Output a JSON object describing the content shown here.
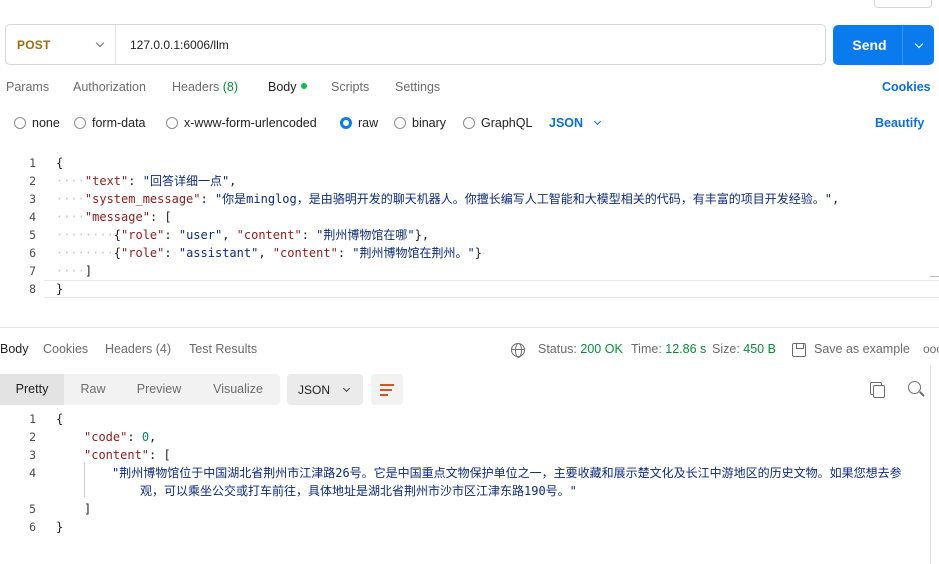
{
  "request": {
    "method": "POST",
    "url": "127.0.0.1:6006/llm",
    "send_label": "Send"
  },
  "request_tabs": {
    "params": "Params",
    "authorization": "Authorization",
    "headers": "Headers",
    "headers_count": "(8)",
    "body": "Body",
    "scripts": "Scripts",
    "settings": "Settings",
    "cookies": "Cookies"
  },
  "body_types": {
    "none": "none",
    "form_data": "form-data",
    "urlencoded": "x-www-form-urlencoded",
    "raw": "raw",
    "binary": "binary",
    "graphql": "GraphQL",
    "raw_format": "JSON",
    "beautify": "Beautify"
  },
  "request_body": {
    "line_numbers": [
      "1",
      "2",
      "3",
      "4",
      "5",
      "6",
      "7",
      "8"
    ],
    "open_brace": "{",
    "text_key": "\"text\"",
    "text_value": "\"回答详细一点\"",
    "system_key": "\"system_message\"",
    "system_value": "\"你是minglog，是由骆明开发的聊天机器人。你擅长编写人工智能和大模型相关的代码，有丰富的项目开发经验。\"",
    "message_key": "\"message\"",
    "role_key": "\"role\"",
    "content_key": "\"content\"",
    "msg1_role": "\"user\"",
    "msg1_content": "\"荆州博物馆在哪\"",
    "msg2_role": "\"assistant\"",
    "msg2_content": "\"荆州博物馆在荆州。\"",
    "close_bracket": "]",
    "close_brace": "}"
  },
  "response_tabs": {
    "body": "Body",
    "cookies": "Cookies",
    "headers": "Headers (4)",
    "test_results": "Test Results"
  },
  "response_meta": {
    "status_label": "Status:",
    "status_value": "200 OK",
    "time_label": "Time:",
    "time_value": "12.86 s",
    "size_label": "Size:",
    "size_value": "450 B",
    "save_example": "Save as example",
    "more": "ooo"
  },
  "response_views": {
    "pretty": "Pretty",
    "raw": "Raw",
    "preview": "Preview",
    "visualize": "Visualize",
    "format": "JSON"
  },
  "response_body": {
    "line_numbers": [
      "1",
      "2",
      "3",
      "4",
      "",
      "5",
      "6"
    ],
    "open_brace": "{",
    "code_key": "\"code\"",
    "code_value": "0",
    "content_key": "\"content\"",
    "content_line1": "\"荆州博物馆位于中国湖北省荆州市江津路26号。它是中国重点文物保护单位之一，主要收藏和展示楚文化及长江中游地区的历史文物。如果您想去参",
    "content_line2": "观，可以乘坐公交或打车前往，具体地址是湖北省荆州市沙市区江津东路190号。\"",
    "close_bracket": "]",
    "close_brace": "}"
  },
  "icons": {
    "method_dropdown": "chevron-down-icon",
    "send_dropdown": "chevron-down-icon",
    "globe": "globe-icon",
    "save": "save-icon",
    "wrap": "wrap-lines-icon",
    "copy": "copy-icon",
    "search": "search-icon"
  },
  "colors": {
    "accent": "#097bed",
    "method": "#a06a13",
    "status_ok": "#0b8a3a",
    "json_key": "#8a1c1c",
    "json_string": "#0c2a7a"
  }
}
